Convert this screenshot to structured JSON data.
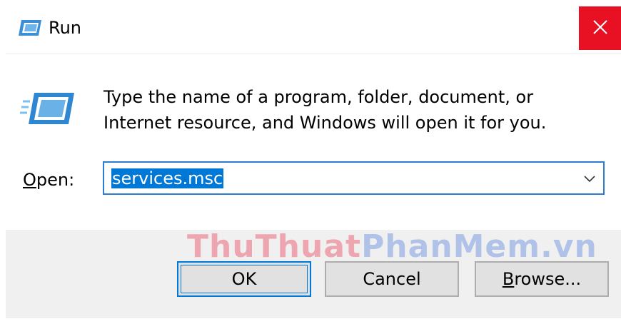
{
  "window": {
    "title": "Run",
    "icon": "run-icon",
    "close_icon": "close-icon"
  },
  "body": {
    "description": "Type the name of a program, folder, document, or Internet resource, and Windows will open it for you.",
    "open_label_prefix": "O",
    "open_label_rest": "pen:",
    "open_value": "services.msc"
  },
  "buttons": {
    "ok": "OK",
    "cancel": "Cancel",
    "browse_prefix": "B",
    "browse_rest": "rowse..."
  },
  "watermark": {
    "part1": "ThuThuat",
    "part2": "PhanMem.vn"
  },
  "colors": {
    "close_bg": "#e81123",
    "focus_blue": "#0078d7",
    "button_area_bg": "#f0f0f0"
  }
}
